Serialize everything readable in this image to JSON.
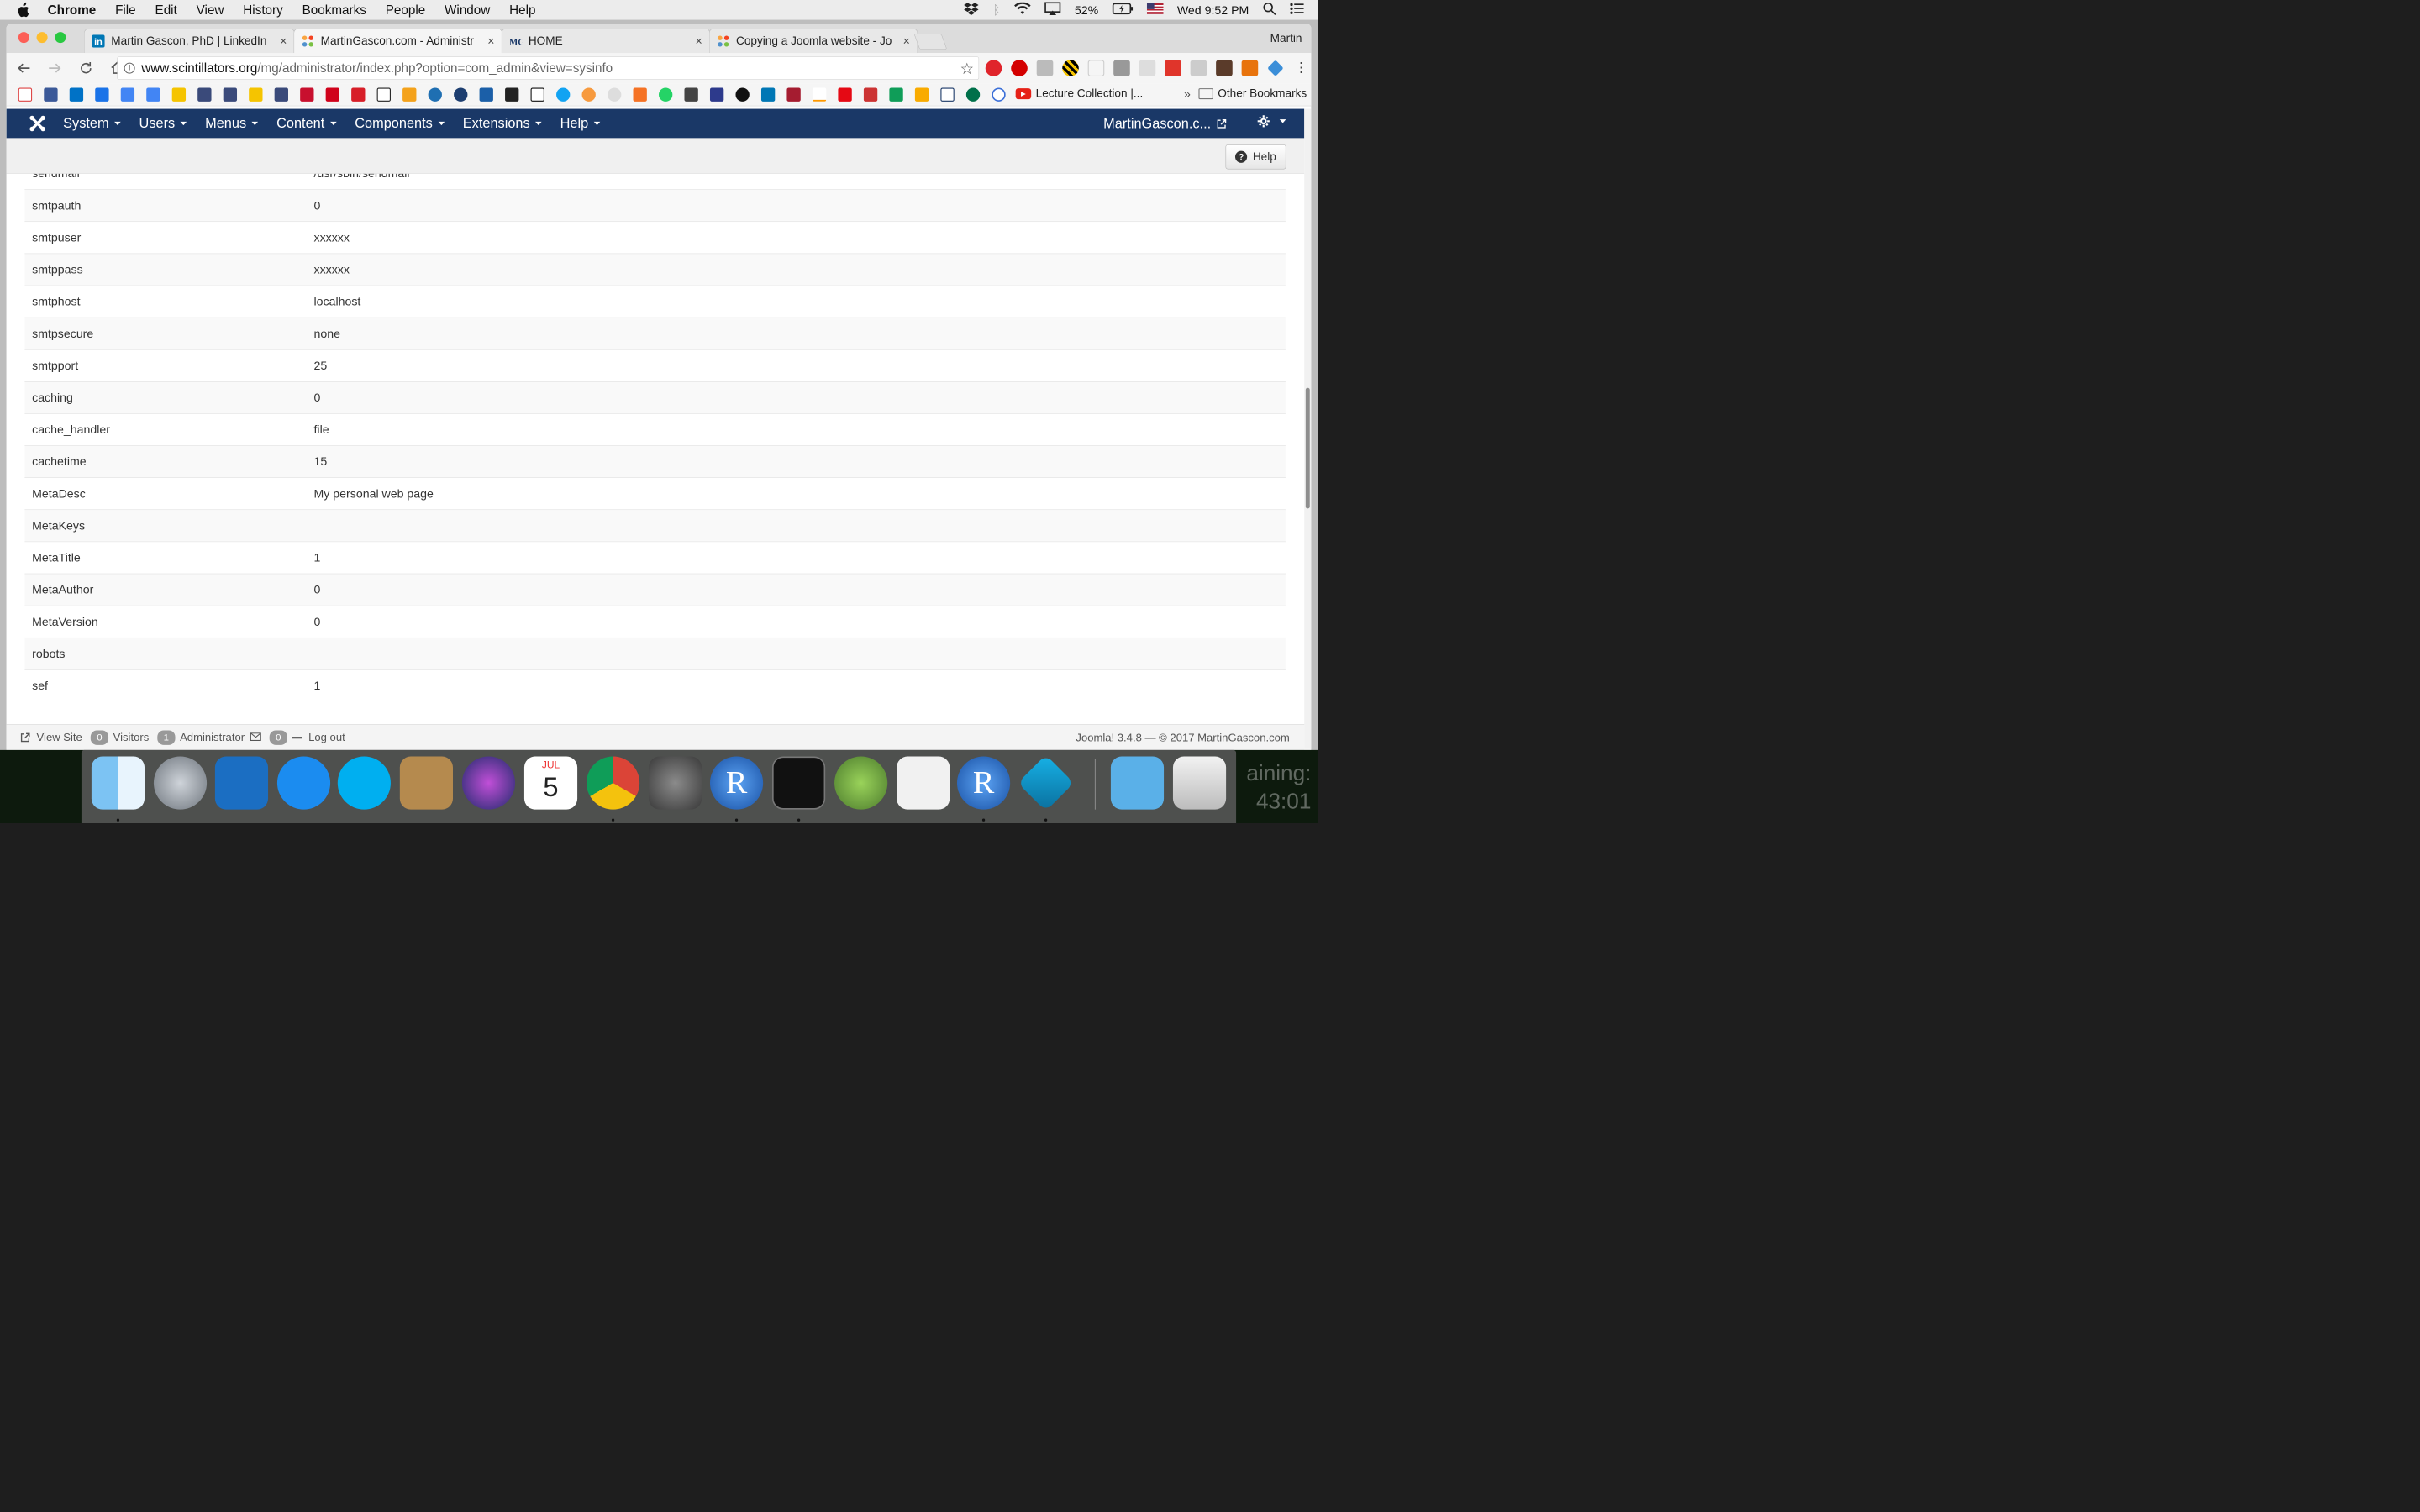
{
  "menubar": {
    "app": "Chrome",
    "items": [
      "File",
      "Edit",
      "View",
      "History",
      "Bookmarks",
      "People",
      "Window",
      "Help"
    ],
    "battery": "52%",
    "clock": "Wed 9:52 PM"
  },
  "tabs": [
    {
      "title": "Martin Gascon, PhD | LinkedIn",
      "close": "×"
    },
    {
      "title": "MartinGascon.com - Administr",
      "close": "×"
    },
    {
      "title": "HOME",
      "close": "×"
    },
    {
      "title": "Copying a Joomla website - Jo",
      "close": "×"
    }
  ],
  "profile": "Martin",
  "address": {
    "host": "www.scintillators.org",
    "path": "/mg/administrator/index.php?option=com_admin&view=sysinfo"
  },
  "bookmarks": {
    "lecture": "Lecture Collection |...",
    "more": "»",
    "other": "Other Bookmarks"
  },
  "joomla": {
    "nav": [
      "System",
      "Users",
      "Menus",
      "Content",
      "Components",
      "Extensions",
      "Help"
    ],
    "site_link": "MartinGascon.c...",
    "help_button": "Help",
    "rows": [
      {
        "key": "sendmail",
        "value": "/usr/sbin/sendmail"
      },
      {
        "key": "smtpauth",
        "value": "0"
      },
      {
        "key": "smtpuser",
        "value": "xxxxxx"
      },
      {
        "key": "smtppass",
        "value": "xxxxxx"
      },
      {
        "key": "smtphost",
        "value": "localhost"
      },
      {
        "key": "smtpsecure",
        "value": "none"
      },
      {
        "key": "smtpport",
        "value": "25"
      },
      {
        "key": "caching",
        "value": "0"
      },
      {
        "key": "cache_handler",
        "value": "file"
      },
      {
        "key": "cachetime",
        "value": "15"
      },
      {
        "key": "MetaDesc",
        "value": "My personal web page"
      },
      {
        "key": "MetaKeys",
        "value": ""
      },
      {
        "key": "MetaTitle",
        "value": "1"
      },
      {
        "key": "MetaAuthor",
        "value": "0"
      },
      {
        "key": "MetaVersion",
        "value": "0"
      },
      {
        "key": "robots",
        "value": ""
      },
      {
        "key": "sef",
        "value": "1"
      }
    ],
    "status": {
      "view_site": "View Site",
      "visitors_count": "0",
      "visitors_label": "Visitors",
      "admin_count": "1",
      "admin_label": "Administrator",
      "messages_count": "0",
      "logout": "Log out",
      "footer": "Joomla! 3.4.8  —  © 2017 MartinGascon.com"
    }
  },
  "dock": {
    "calendar_month": "JUL",
    "calendar_day": "5",
    "overlay_line1": "aining:",
    "overlay_line2": "43:01"
  }
}
